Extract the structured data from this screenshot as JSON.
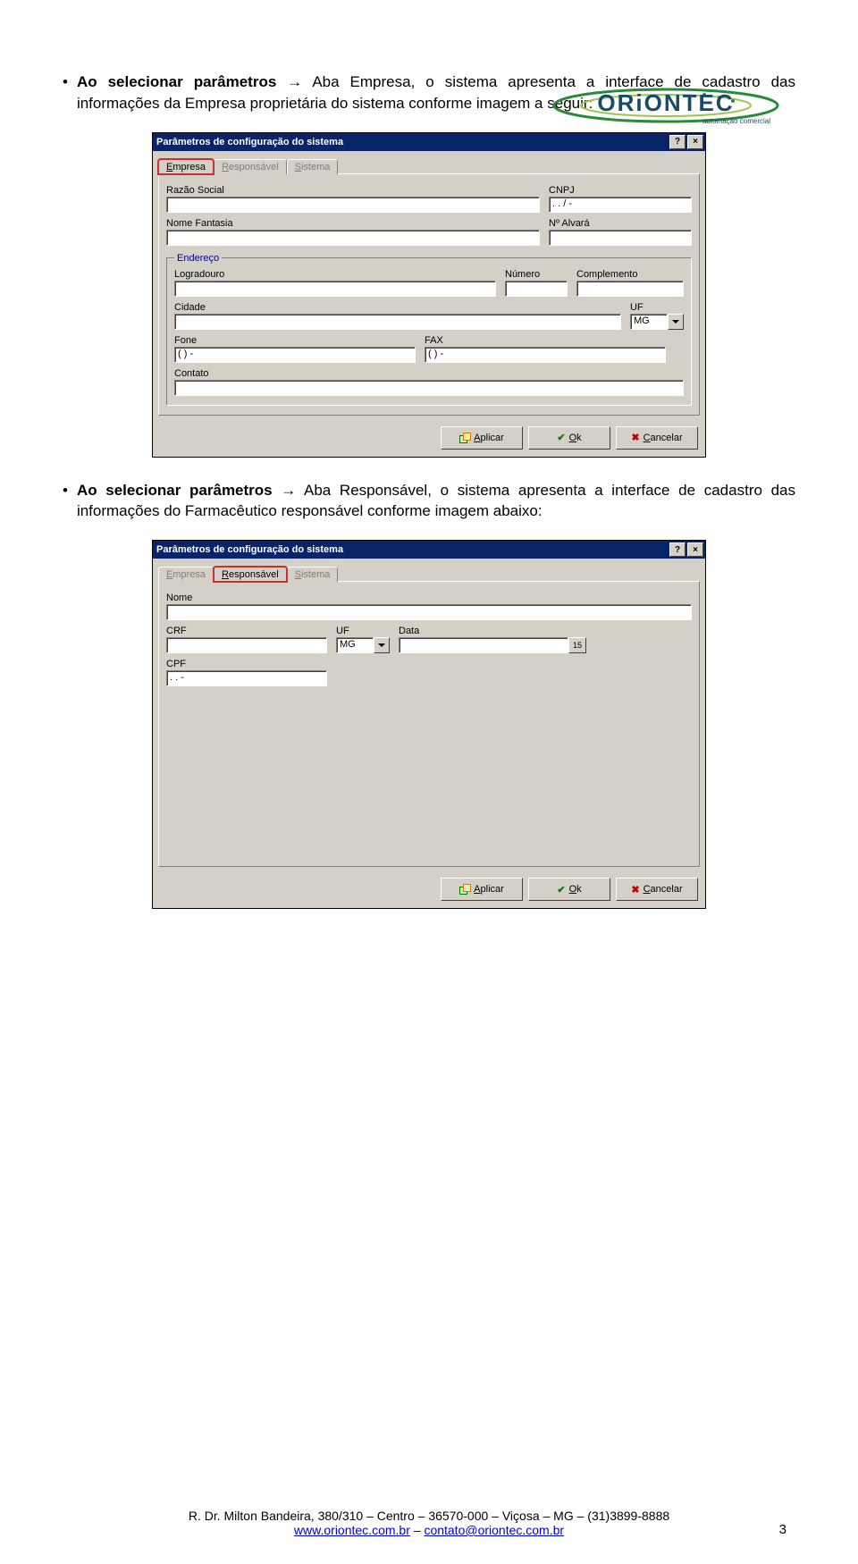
{
  "logo": {
    "brand": "ORiONTEC",
    "tagline": "automação comercial"
  },
  "para1": {
    "prefix": "Ao selecionar parâmetros ",
    "arrow": "→",
    "mid": " Aba Empresa, o sistema apresenta a interface de cadastro das informações da Empresa proprietária do sistema conforme imagem a seguir:"
  },
  "para2": {
    "prefix": "Ao selecionar parâmetros ",
    "arrow": "→",
    "mid": " Aba Responsável, o sistema apresenta a interface de cadastro das informações do Farmacêutico responsável conforme imagem abaixo:"
  },
  "dialog1": {
    "title": "Parâmetros de configuração do sistema",
    "tabs": {
      "empresa": "Empresa",
      "responsavel": "Responsável",
      "sistema": "Sistema"
    },
    "labels": {
      "razao": "Razão Social",
      "cnpj": "CNPJ",
      "nome_fantasia": "Nome Fantasia",
      "n_alvara": "Nº Alvará",
      "endereco_group": "Endereço",
      "logradouro": "Logradouro",
      "numero": "Número",
      "complemento": "Complemento",
      "cidade": "Cidade",
      "uf": "UF",
      "fone": "Fone",
      "fax": "FAX",
      "contato": "Contato"
    },
    "values": {
      "razao": "",
      "cnpj": "  .   .   /    -",
      "nome_fantasia": "",
      "n_alvara": "",
      "logradouro": "",
      "numero": "",
      "complemento": "",
      "cidade": "",
      "uf": "MG",
      "fone": "(  )    -",
      "fax": "(  )    -",
      "contato": ""
    },
    "buttons": {
      "aplicar": "Aplicar",
      "ok": "Ok",
      "cancelar": "Cancelar"
    }
  },
  "dialog2": {
    "title": "Parâmetros de configuração do sistema",
    "tabs": {
      "empresa": "Empresa",
      "responsavel": "Responsável",
      "sistema": "Sistema"
    },
    "labels": {
      "nome": "Nome",
      "crf": "CRF",
      "uf": "UF",
      "data": "Data",
      "cpf": "CPF"
    },
    "values": {
      "nome": "",
      "crf": "",
      "uf": "MG",
      "data": "",
      "cpf": "   .   .   -"
    },
    "buttons": {
      "aplicar": "Aplicar",
      "ok": "Ok",
      "cancelar": "Cancelar"
    }
  },
  "footer": {
    "line1": "R. Dr. Milton Bandeira, 380/310 – Centro – 36570-000 – Viçosa – MG – (31)3899-8888",
    "site": "www.oriontec.com.br",
    "sep": "   –   ",
    "email": "contato@oriontec.com.br"
  },
  "page_number": "3",
  "icons": {
    "help": "?",
    "close": "×",
    "cal": "15"
  },
  "underline": {
    "E": "E",
    "mpresa": "mpresa",
    "R": "R",
    "esponsavel": "esponsável",
    "S": "S",
    "istema": "istema",
    "A": "A",
    "plicar": "plicar",
    "O": "O",
    "k": "k",
    "C": "C",
    "ancelar": "ancelar"
  }
}
